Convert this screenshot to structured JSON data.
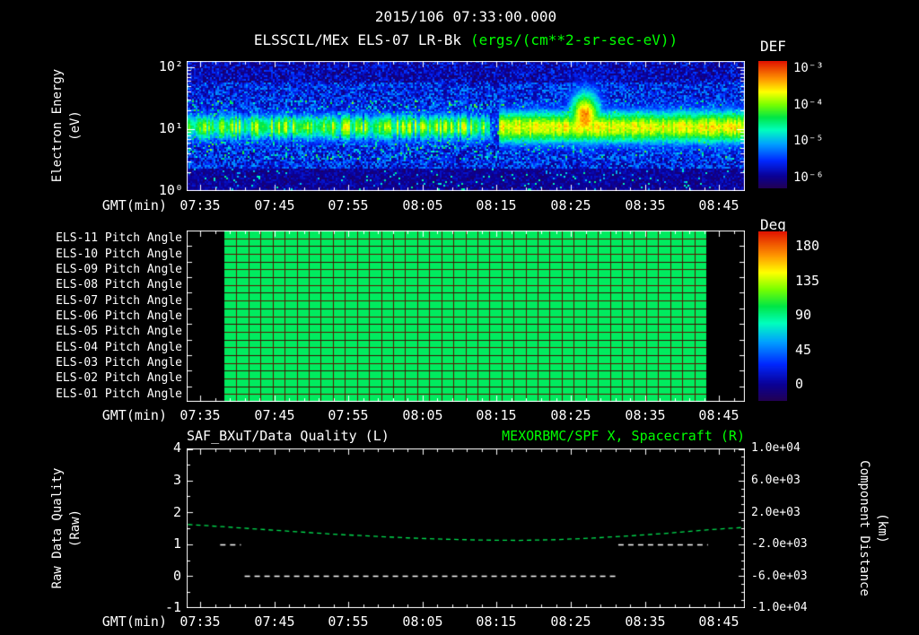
{
  "header": {
    "timestamp": "2015/106 07:33:00.000",
    "instrument": "ELSSCIL/MEx ELS-07 LR-Bk",
    "units": "(ergs/(cm**2-sr-sec-eV))"
  },
  "axes": {
    "gmt_label": "GMT(min)",
    "time_labels": [
      "07:35",
      "07:45",
      "07:55",
      "08:05",
      "08:15",
      "08:25",
      "08:35",
      "08:45"
    ]
  },
  "colorbars": {
    "def": {
      "title": "DEF",
      "tick_labels": [
        "10⁻³",
        "10⁻⁴",
        "10⁻⁵",
        "10⁻⁶"
      ]
    },
    "deg": {
      "title": "Deg",
      "tick_labels": [
        "180",
        "135",
        "90",
        "45",
        "0"
      ]
    }
  },
  "spectrogram_panel": {
    "ylabel_line1": "Electron Energy",
    "ylabel_line2": "(eV)",
    "y_tick_labels": [
      "10²",
      "10¹",
      "10⁰"
    ]
  },
  "pitch_panel": {
    "row_labels": [
      "ELS-11 Pitch Angle",
      "ELS-10 Pitch Angle",
      "ELS-09 Pitch Angle",
      "ELS-08 Pitch Angle",
      "ELS-07 Pitch Angle",
      "ELS-06 Pitch Angle",
      "ELS-05 Pitch Angle",
      "ELS-04 Pitch Angle",
      "ELS-03 Pitch Angle",
      "ELS-02 Pitch Angle",
      "ELS-01 Pitch Angle"
    ]
  },
  "quality_panel": {
    "title_left": "SAF_BXuT/Data Quality (L)",
    "title_right": "MEXORBMC/SPF X, Spacecraft (R)",
    "ylabel_left_line1": "Raw Data Quality",
    "ylabel_left_line2": "(Raw)",
    "ylabel_right_line1": "Component Distance",
    "ylabel_right_line2": "(km)",
    "y_tick_labels_left": [
      "4",
      "3",
      "2",
      "1",
      "0",
      "-1"
    ],
    "y_tick_labels_right": [
      "1.0e+04",
      "6.0e+03",
      "2.0e+03",
      "-2.0e+03",
      "-6.0e+03",
      "-1.0e+04"
    ]
  },
  "colors": {
    "background": "#000000",
    "text": "#ffffff",
    "accent_green": "#00ff00",
    "quality_line": "#ffffff",
    "distance_line": "#00e050",
    "pitch_grid": "#5a1800"
  },
  "chart_data": [
    {
      "type": "heatmap",
      "name": "electron-energy-spectrogram",
      "title": "ELSSCIL/MEx ELS-07 LR-Bk",
      "units": "ergs/(cm**2-sr-sec-eV)",
      "xlabel": "GMT(min)",
      "ylabel": "Electron Energy (eV)",
      "x_time_start": "07:33",
      "x_time_end": "08:49",
      "x_tick_labels": [
        "07:35",
        "07:45",
        "07:55",
        "08:05",
        "08:15",
        "08:25",
        "08:35",
        "08:45"
      ],
      "x_tick_minutes": [
        2,
        12,
        22,
        32,
        42,
        52,
        62,
        72
      ],
      "y_scale": "log",
      "y_range_ev": [
        1,
        126
      ],
      "y_log_top": 2.1,
      "colorbar": {
        "label": "DEF",
        "scale": "log",
        "range_log10": [
          -6.5,
          -3.0
        ]
      },
      "background_log_def": [
        -6.3,
        -5.25
      ],
      "band": {
        "center_ev": 10.7,
        "center_log": 1.03,
        "sigma_log_pre": 0.16,
        "sigma_log_post": 0.2,
        "peak_log_def_pre": -4.4,
        "peak_log_def_post": -3.85
      },
      "dropout_minutes": [
        40.9,
        42.2
      ],
      "burst": {
        "center_minute": 53.8,
        "sigma_minutes": 1.6,
        "center_log_e": 1.2,
        "sigma_log_e": 0.3,
        "peak_log_def": -3.4
      }
    },
    {
      "type": "heatmap",
      "name": "pitch-angle-panels",
      "rows": [
        "ELS-11",
        "ELS-10",
        "ELS-09",
        "ELS-08",
        "ELS-07",
        "ELS-06",
        "ELS-05",
        "ELS-04",
        "ELS-03",
        "ELS-02",
        "ELS-01"
      ],
      "value_deg": 97,
      "coverage_minutes": [
        5.3,
        70.3
      ],
      "grid_cols": 40,
      "grid_subrows": 22,
      "colorbar": {
        "label": "Deg",
        "range": [
          0,
          180
        ],
        "ticks": [
          180,
          135,
          90,
          45,
          0
        ]
      }
    },
    {
      "type": "line",
      "name": "quality-and-spacecraft-distance",
      "title_left": "SAF_BXuT/Data Quality (L)",
      "title_right": "MEXORBMC/SPF X, Spacecraft (R)",
      "xlabel": "GMT(min)",
      "ylabel_left": "Raw Data Quality (Raw)",
      "ylabel_right": "Component Distance (km)",
      "ylim_left": [
        -1,
        4
      ],
      "ylim_right": [
        -10000,
        10000
      ],
      "x_tick_minutes": [
        2,
        12,
        22,
        32,
        42,
        52,
        62,
        72
      ],
      "series": [
        {
          "name": "MEXORBMC/SPF X Spacecraft",
          "axis": "right",
          "color": "#00e050",
          "style": "dashed",
          "points_min_km": [
            [
              0,
              480
            ],
            [
              5,
              200
            ],
            [
              10,
              -120
            ],
            [
              15,
              -430
            ],
            [
              20,
              -740
            ],
            [
              25,
              -980
            ],
            [
              30,
              -1210
            ],
            [
              35,
              -1370
            ],
            [
              40,
              -1480
            ],
            [
              45,
              -1520
            ],
            [
              50,
              -1430
            ],
            [
              55,
              -1230
            ],
            [
              60,
              -950
            ],
            [
              65,
              -630
            ],
            [
              70,
              -230
            ],
            [
              75,
              90
            ]
          ]
        },
        {
          "name": "SAF_BXuT Data Quality",
          "axis": "left",
          "color": "#ffffff",
          "style": "dashed",
          "segments": [
            {
              "value": 1,
              "from_min": 4.7,
              "to_min": 7.5
            },
            {
              "value": 0,
              "from_min": 8.0,
              "to_min": 58.4
            },
            {
              "value": 1,
              "from_min": 58.4,
              "to_min": 70.5
            }
          ]
        }
      ]
    }
  ]
}
